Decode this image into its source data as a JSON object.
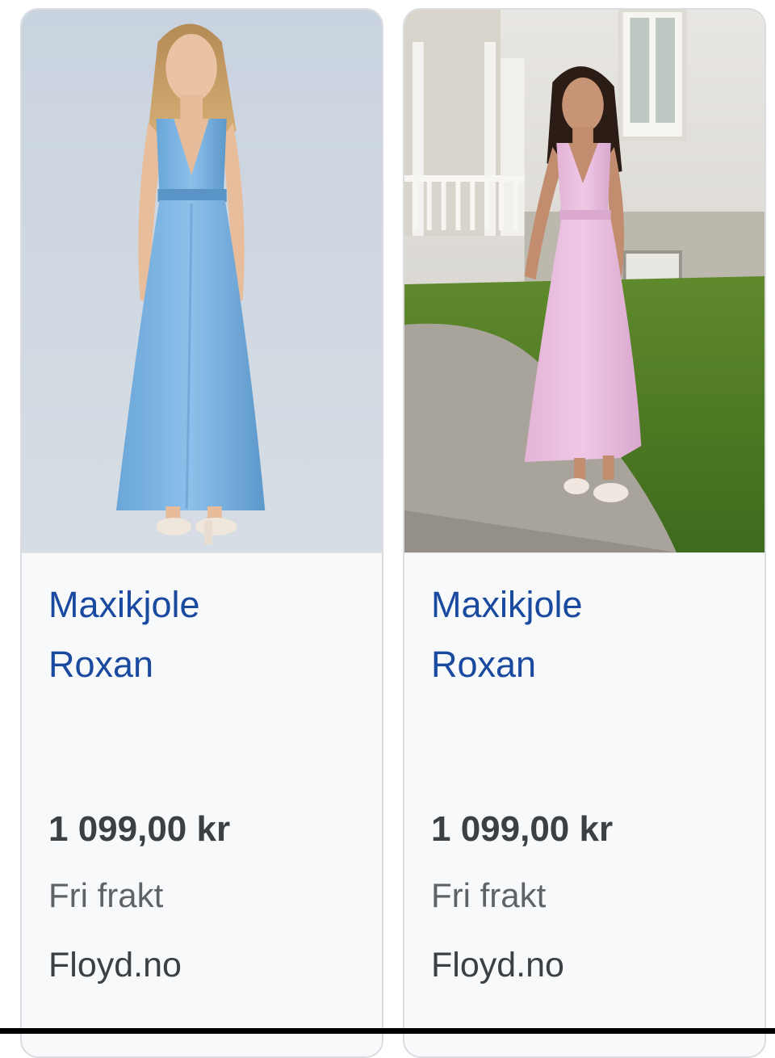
{
  "products": [
    {
      "image_alt": "model-blue-maxi-dress",
      "title_line1": "Maxikjole",
      "title_line2": "Roxan",
      "price": "1 099,00 kr",
      "shipping": "Fri frakt",
      "merchant": "Floyd.no"
    },
    {
      "image_alt": "model-pink-maxi-dress",
      "title_line1": "Maxikjole",
      "title_line2": "Roxan",
      "price": "1 099,00 kr",
      "shipping": "Fri frakt",
      "merchant": "Floyd.no"
    }
  ],
  "colors": {
    "title_link": "#1a4aa0",
    "price": "#3c4043",
    "card_bg": "#f8f9fa",
    "card_border": "#dadce0"
  }
}
